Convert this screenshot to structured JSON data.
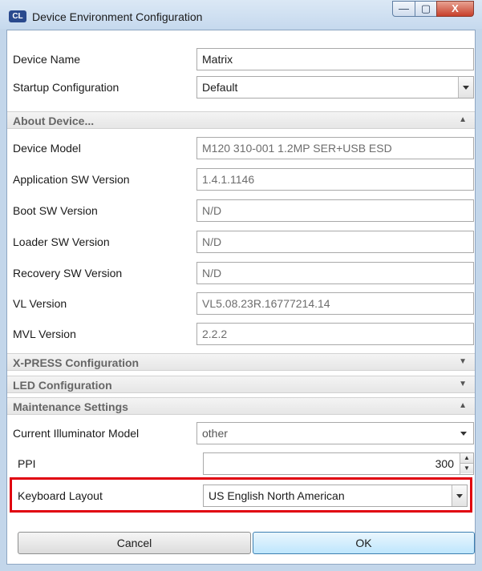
{
  "window": {
    "title": "Device Environment Configuration",
    "app_icon_text": "CL",
    "minimize": "—",
    "maximize": "▢",
    "close": "X"
  },
  "fields": {
    "device_name": {
      "label": "Device Name",
      "value": "Matrix"
    },
    "startup_configuration": {
      "label": "Startup Configuration",
      "value": "Default"
    }
  },
  "sections": {
    "about_device": "About Device...",
    "xpress": "X-PRESS Configuration",
    "led": "LED Configuration",
    "maintenance": "Maintenance Settings"
  },
  "about": {
    "device_model": {
      "label": "Device Model",
      "value": "M120 310-001 1.2MP SER+USB ESD"
    },
    "app_sw_version": {
      "label": "Application SW Version",
      "value": "1.4.1.1146"
    },
    "boot_sw_version": {
      "label": "Boot SW Version",
      "value": "N/D"
    },
    "loader_sw_version": {
      "label": "Loader SW Version",
      "value": "N/D"
    },
    "recovery_sw_version": {
      "label": "Recovery SW Version",
      "value": "N/D"
    },
    "vl_version": {
      "label": "VL Version",
      "value": "VL5.08.23R.16777214.14"
    },
    "mvl_version": {
      "label": "MVL Version",
      "value": "2.2.2"
    }
  },
  "maintenance": {
    "current_illuminator_model": {
      "label": "Current Illuminator Model",
      "value": "other"
    },
    "ppi": {
      "label": "PPI",
      "value": "300"
    },
    "keyboard_layout": {
      "label": "Keyboard Layout",
      "value": "US English North American"
    }
  },
  "buttons": {
    "cancel": "Cancel",
    "ok": "OK"
  },
  "colors": {
    "highlight_border": "#e0000f",
    "title_bar": "#c6d9ee",
    "close_button": "#c7402b"
  }
}
